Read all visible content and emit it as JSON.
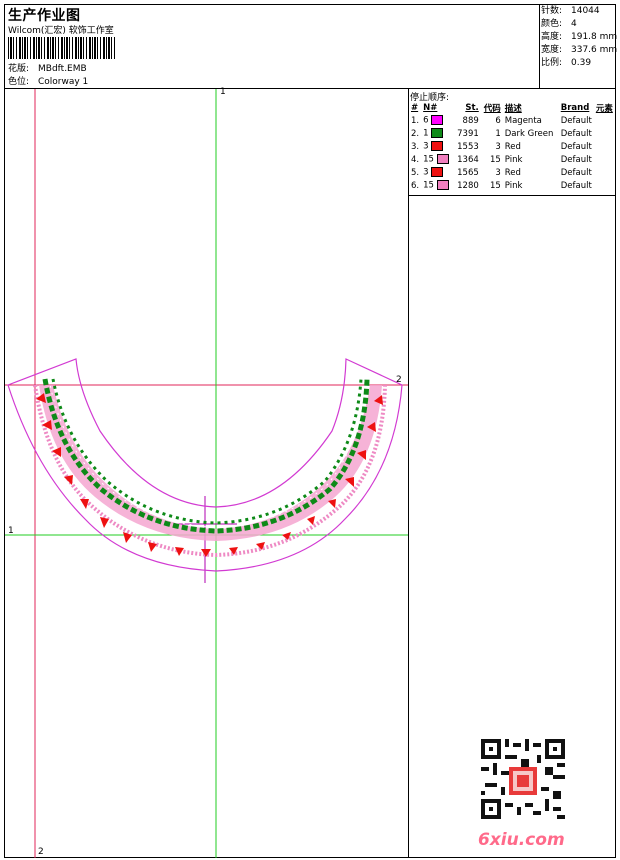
{
  "header": {
    "title": "生产作业图",
    "company": "Wilcom(汇宏) 软饰工作室",
    "design_label": "花版:",
    "design_value": "MBdft.EMB",
    "colorway_label": "色位:",
    "colorway_value": "Colorway 1"
  },
  "stats": [
    {
      "label": "针数:",
      "value": "14044"
    },
    {
      "label": "颜色:",
      "value": "4"
    },
    {
      "label": "高度:",
      "value": "191.8 mm"
    },
    {
      "label": "宽度:",
      "value": "337.6 mm"
    },
    {
      "label": "比例:",
      "value": "0.39"
    }
  ],
  "stop_sequence": {
    "title": "停止顺序:",
    "headers": [
      "#",
      "N#",
      "St.",
      "代码",
      "描述",
      "Brand",
      "元素"
    ],
    "rows": [
      {
        "idx": "1.",
        "n": "6",
        "color": "#ff00ff",
        "st": "889",
        "code": "6",
        "desc": "Magenta",
        "brand": "Default"
      },
      {
        "idx": "2.",
        "n": "1",
        "color": "#0e8a18",
        "st": "7391",
        "code": "1",
        "desc": "Dark Green",
        "brand": "Default"
      },
      {
        "idx": "3.",
        "n": "3",
        "color": "#ee1111",
        "st": "1553",
        "code": "3",
        "desc": "Red",
        "brand": "Default"
      },
      {
        "idx": "4.",
        "n": "15",
        "color": "#f07fbf",
        "st": "1364",
        "code": "15",
        "desc": "Pink",
        "brand": "Default"
      },
      {
        "idx": "5.",
        "n": "3",
        "color": "#ee1111",
        "st": "1565",
        "code": "3",
        "desc": "Red",
        "brand": "Default"
      },
      {
        "idx": "6.",
        "n": "15",
        "color": "#f07fbf",
        "st": "1280",
        "code": "15",
        "desc": "Pink",
        "brand": "Default"
      }
    ]
  },
  "axes": {
    "green_top": "1",
    "green_left": "1",
    "red_right": "2",
    "red_bottom": "2"
  },
  "watermark": "6xiu.com"
}
